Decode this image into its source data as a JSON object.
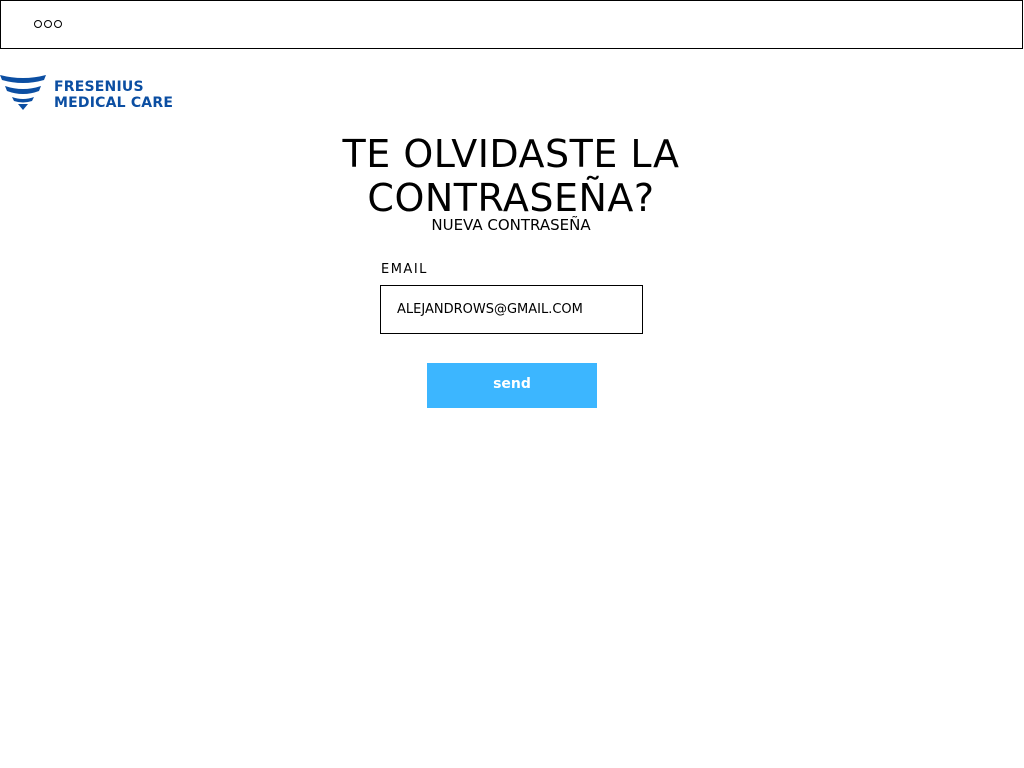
{
  "header": {
    "menu_icon": "three-dots-icon"
  },
  "brand": {
    "line1": "FRESENIUS",
    "line2": "MEDICAL CARE",
    "color": "#0b4ea2"
  },
  "page": {
    "title_line1": "TE OLVIDASTE LA",
    "title_line2": "CONTRASEÑA?",
    "subtitle": "NUEVA CONTRASEÑA"
  },
  "form": {
    "email_label": "EMAIL",
    "email_value": "ALEJANDROWS@GMAIL.COM",
    "send_label": "send",
    "button_color": "#3cb6ff"
  }
}
